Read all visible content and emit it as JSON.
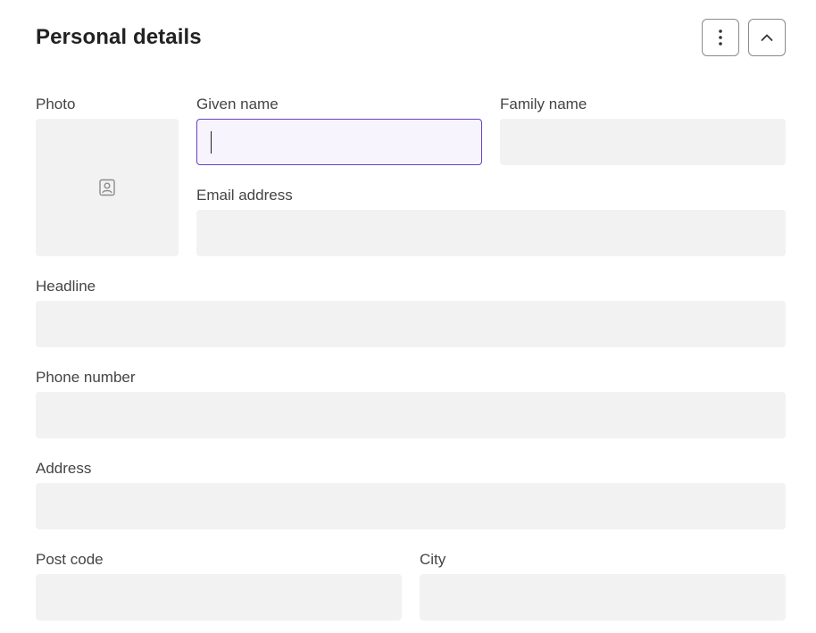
{
  "section": {
    "title": "Personal details"
  },
  "header_icons": {
    "more": "more-vertical-icon",
    "collapse": "chevron-up-icon"
  },
  "photo": {
    "label": "Photo",
    "icon": "contact-portrait-icon"
  },
  "fields": {
    "given_name": {
      "label": "Given name",
      "value": ""
    },
    "family_name": {
      "label": "Family name",
      "value": ""
    },
    "email": {
      "label": "Email address",
      "value": ""
    },
    "headline": {
      "label": "Headline",
      "value": ""
    },
    "phone": {
      "label": "Phone number",
      "value": ""
    },
    "address": {
      "label": "Address",
      "value": ""
    },
    "post_code": {
      "label": "Post code",
      "value": ""
    },
    "city": {
      "label": "City",
      "value": ""
    }
  },
  "colors": {
    "focus_border": "#6b3fc4",
    "focus_fill": "#f7f4fd",
    "field_fill": "#f2f2f2"
  }
}
